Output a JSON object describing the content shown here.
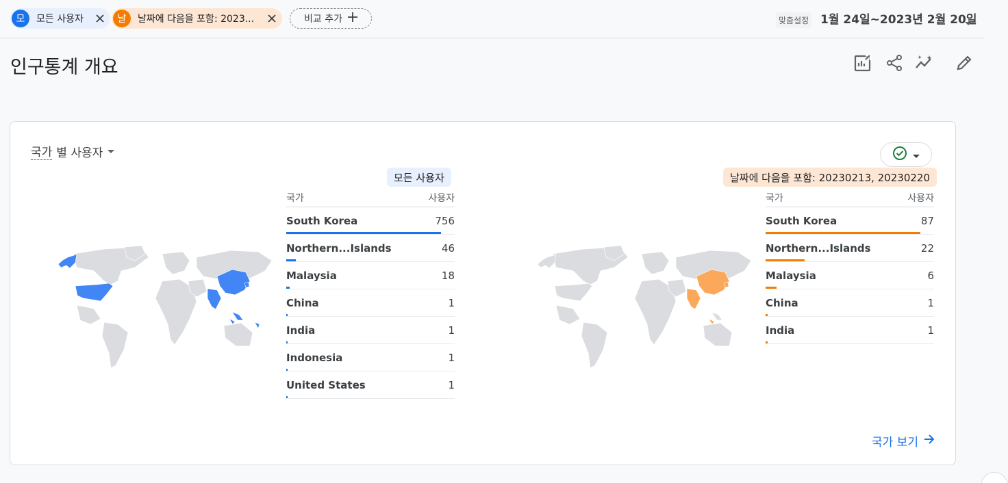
{
  "filters": {
    "segment1": {
      "badge": "모",
      "label": "모든 사용자"
    },
    "segment2": {
      "badge": "날",
      "label": "날짜에 다음을 포함: 2023..."
    },
    "add_compare": "비교 추가"
  },
  "date": {
    "mode_label": "맞춤설정",
    "range": "1월 24일~2023년 2월 20일"
  },
  "page": {
    "title": "인구통계 개요"
  },
  "toolbar": {
    "icons": [
      "customize-report-icon",
      "share-icon",
      "insights-icon",
      "edit-icon"
    ]
  },
  "card": {
    "title_part1": "국가",
    "title_part2": "별 사용자",
    "view_link": "국가 보기",
    "left": {
      "segment": "모든 사용자",
      "col_country": "국가",
      "col_users": "사용자",
      "color": "#1a73e8",
      "map_color": "#4285f4",
      "rows": [
        {
          "country": "South Korea",
          "users": "756",
          "share": 1.0
        },
        {
          "country": "Northern...Islands",
          "users": "46",
          "share": 0.061
        },
        {
          "country": "Malaysia",
          "users": "18",
          "share": 0.024
        },
        {
          "country": "China",
          "users": "1",
          "share": 0.0013
        },
        {
          "country": "India",
          "users": "1",
          "share": 0.0013
        },
        {
          "country": "Indonesia",
          "users": "1",
          "share": 0.0013
        },
        {
          "country": "United States",
          "users": "1",
          "share": 0.0013
        }
      ]
    },
    "right": {
      "segment": "날짜에 다음을 포함: 20230213, 20230220",
      "col_country": "국가",
      "col_users": "사용자",
      "color": "#f57c00",
      "map_color": "#fba85b",
      "rows": [
        {
          "country": "South Korea",
          "users": "87",
          "share": 1.0
        },
        {
          "country": "Northern...Islands",
          "users": "22",
          "share": 0.253
        },
        {
          "country": "Malaysia",
          "users": "6",
          "share": 0.069
        },
        {
          "country": "China",
          "users": "1",
          "share": 0.0115
        },
        {
          "country": "India",
          "users": "1",
          "share": 0.0115
        }
      ]
    }
  }
}
